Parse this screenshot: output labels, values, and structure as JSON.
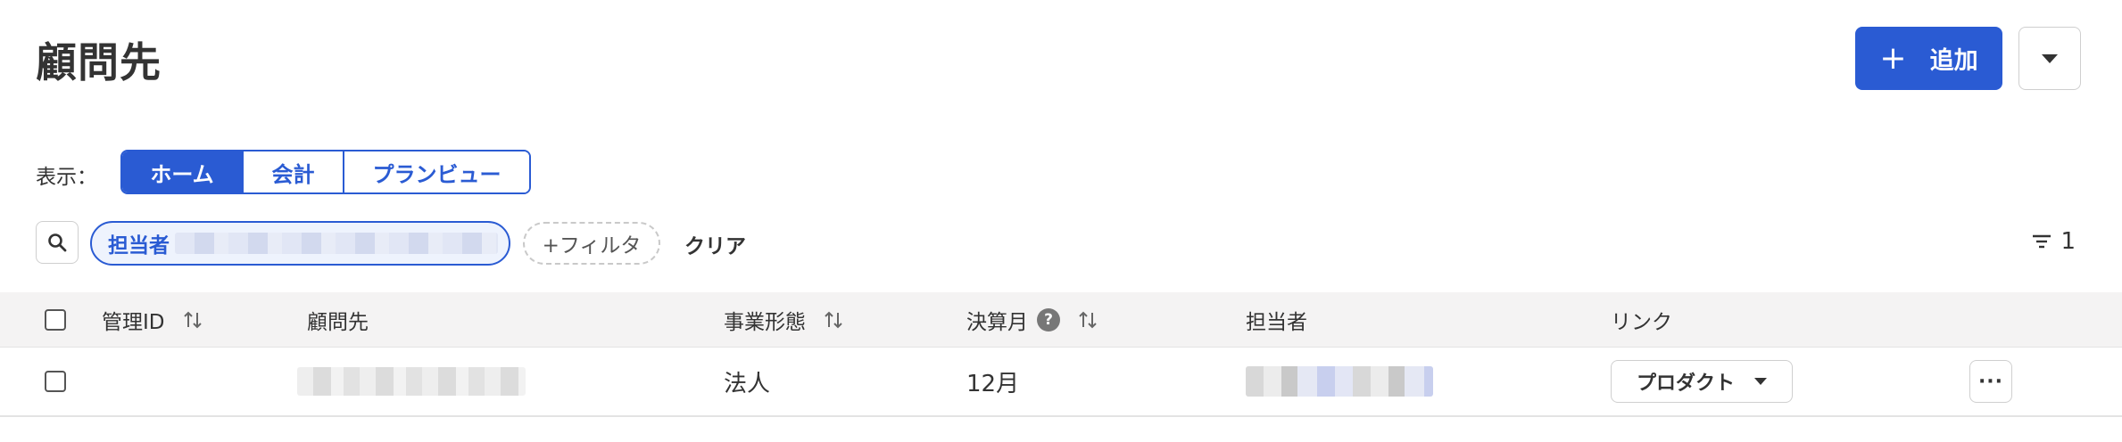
{
  "page": {
    "title": "顧問先"
  },
  "header": {
    "add_label": "追加",
    "add_icon": "plus-icon",
    "more_icon": "caret-down-icon"
  },
  "view": {
    "label": "表示：",
    "options": [
      {
        "label": "ホーム",
        "active": true
      },
      {
        "label": "会計",
        "active": false
      },
      {
        "label": "プランビュー",
        "active": false
      }
    ]
  },
  "filters": {
    "search_icon": "search-icon",
    "chips": [
      {
        "label": "担当者"
      }
    ],
    "add_filter_label": "+フィルタ",
    "clear_label": "クリア",
    "sort_count": "1"
  },
  "table": {
    "columns": [
      "管理ID",
      "顧問先",
      "事業形態",
      "決算月",
      "担当者",
      "リンク"
    ],
    "help_icon_label": "?",
    "rows": [
      {
        "id": "",
        "business_type": "法人",
        "fiscal_month": "12月",
        "link_label": "プロダクト",
        "menu_label": "···"
      }
    ]
  },
  "colors": {
    "accent": "#2a5bd3",
    "header_bg": "#f4f3f3",
    "chip_bg": "#eef3fd"
  }
}
